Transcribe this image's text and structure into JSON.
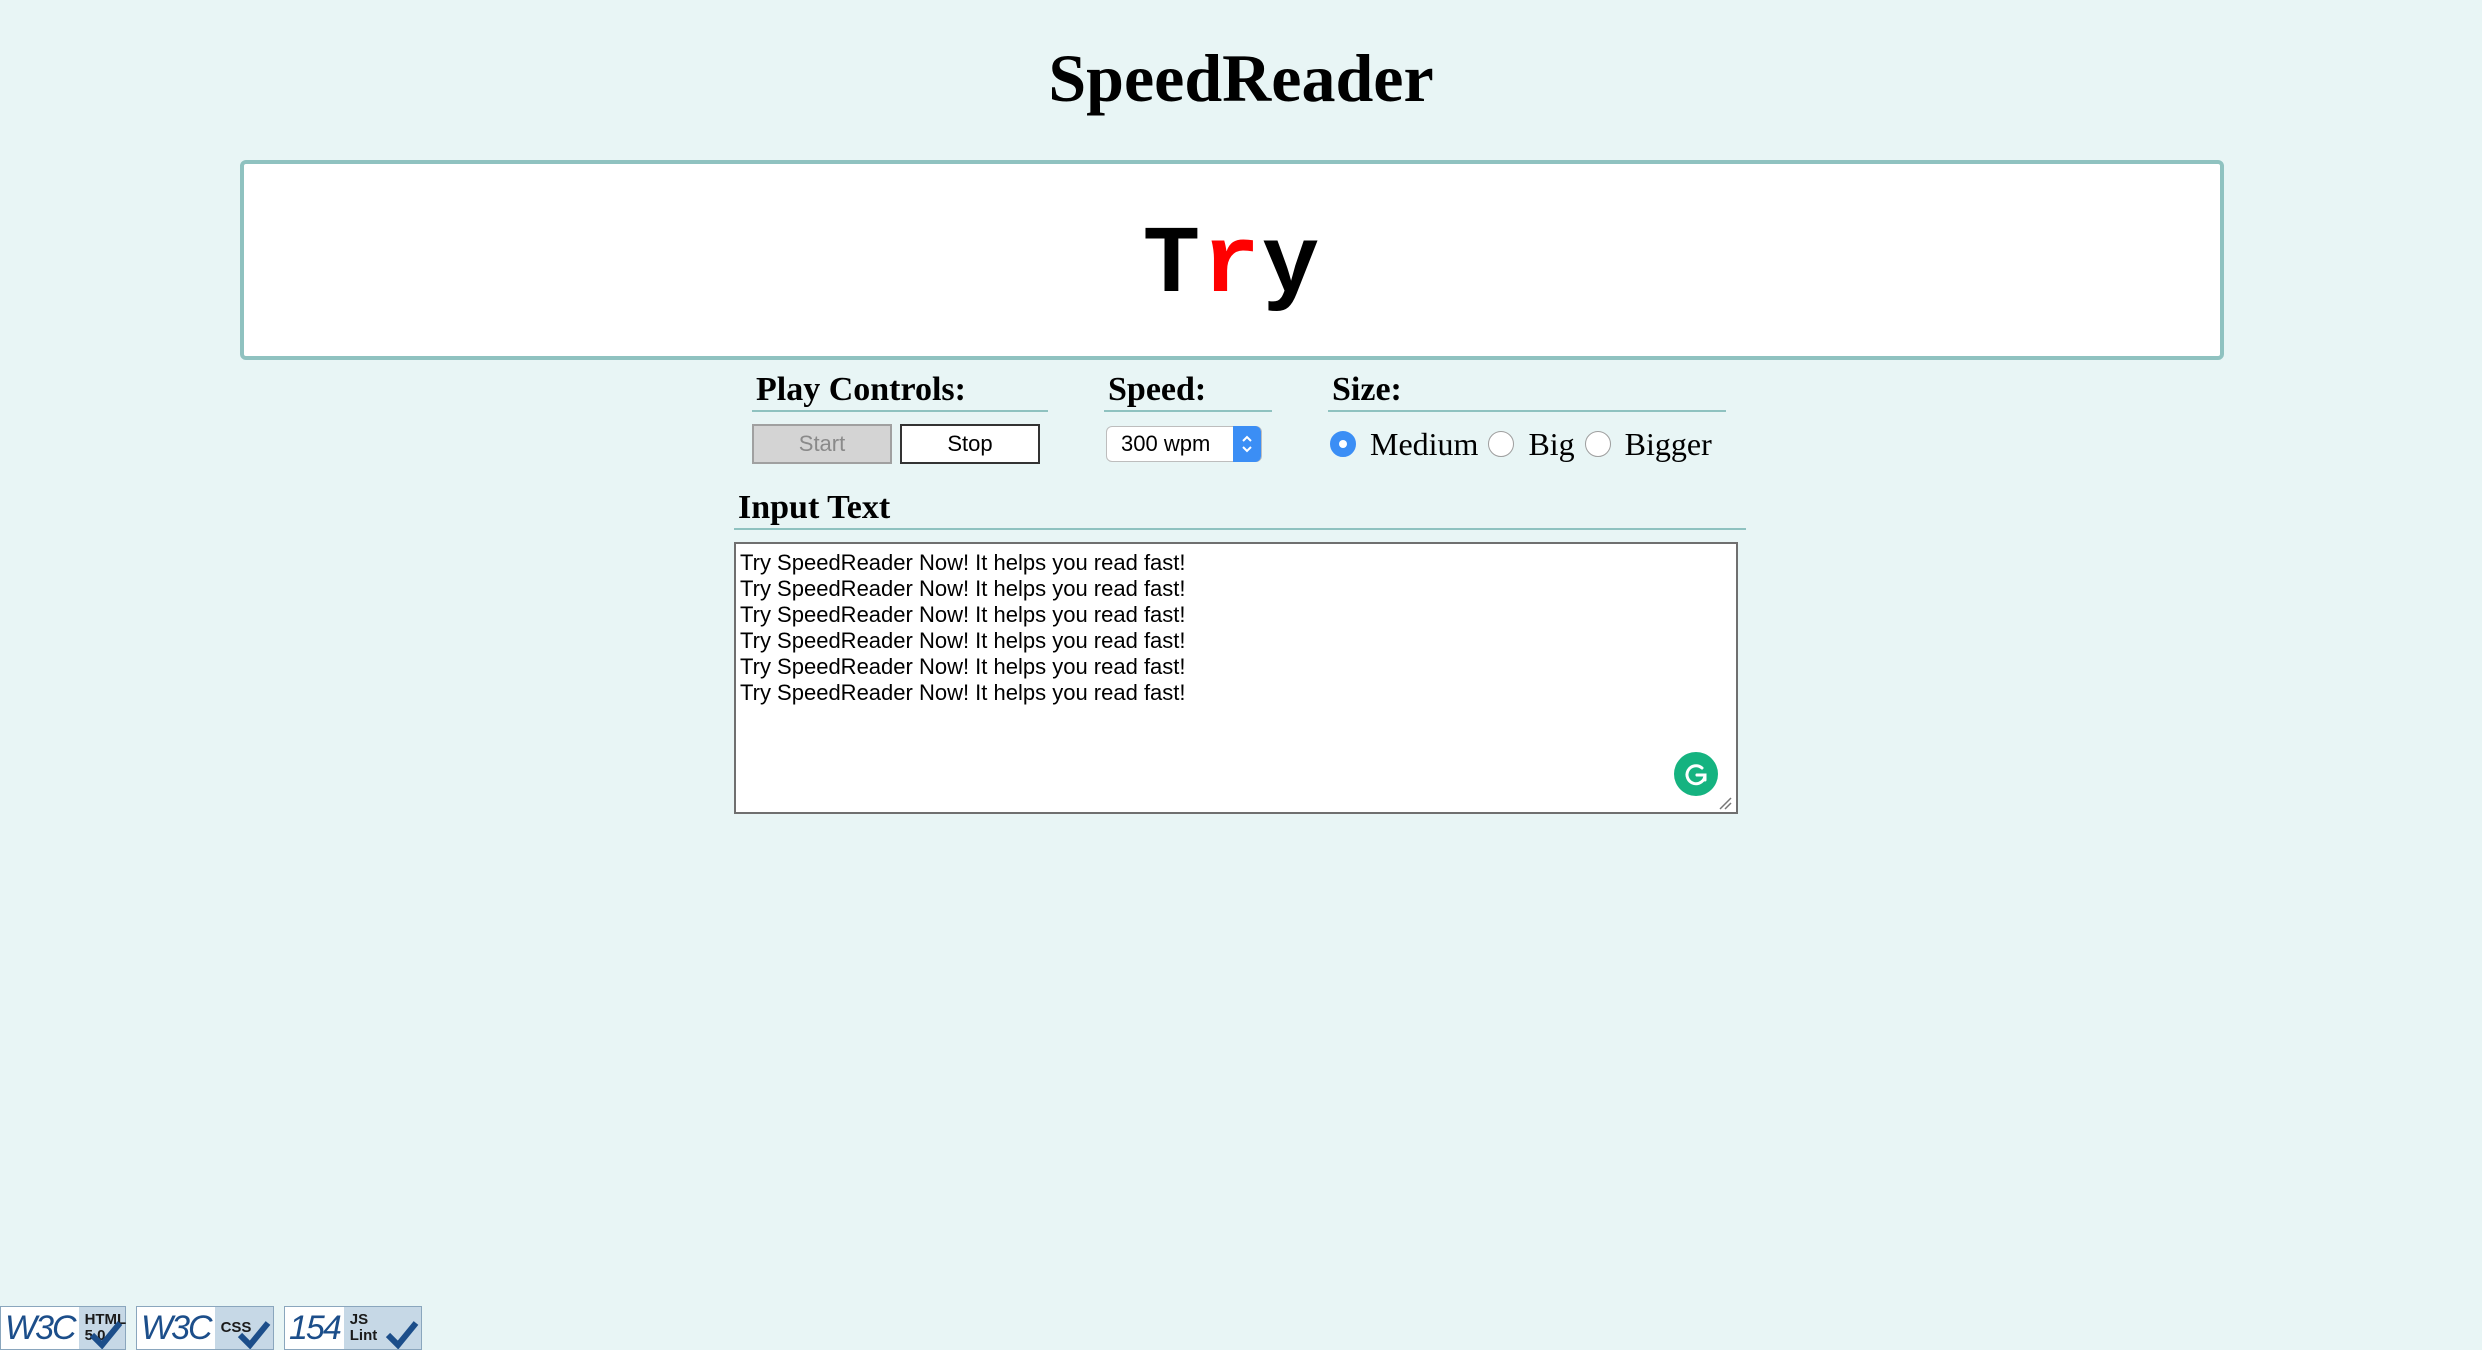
{
  "page": {
    "title": "SpeedReader"
  },
  "display": {
    "word_pre": "T",
    "word_focus": "r",
    "word_post": "y",
    "focus_color": "#ff0000"
  },
  "controls": {
    "play_heading": "Play Controls:",
    "start_label": "Start",
    "stop_label": "Stop",
    "start_enabled": false,
    "speed_heading": "Speed:",
    "speed_value": "300 wpm",
    "size_heading": "Size:",
    "size_options": [
      {
        "label": "Medium",
        "checked": true
      },
      {
        "label": "Big",
        "checked": false
      },
      {
        "label": "Bigger",
        "checked": false
      }
    ]
  },
  "input": {
    "heading": "Input Text",
    "text": "Try SpeedReader Now! It helps you read fast!\nTry SpeedReader Now! It helps you read fast!\nTry SpeedReader Now! It helps you read fast!\nTry SpeedReader Now! It helps you read fast!\nTry SpeedReader Now! It helps you read fast!\nTry SpeedReader Now! It helps you read fast!"
  },
  "badges": [
    {
      "logo": "W3C",
      "text": "HTML\n5.0"
    },
    {
      "logo": "W3C",
      "text": "CSS"
    },
    {
      "logo": "154",
      "text": "JS\nLint"
    }
  ],
  "colors": {
    "background": "#e8f5f5",
    "accent_border": "#8fc2c0",
    "radio_checked": "#3b8ef5",
    "grammarly": "#15b380"
  },
  "icons": {
    "grammarly": "grammarly-icon",
    "select_arrows": "updown-chevron-icon",
    "badge_check": "checkmark-icon"
  }
}
